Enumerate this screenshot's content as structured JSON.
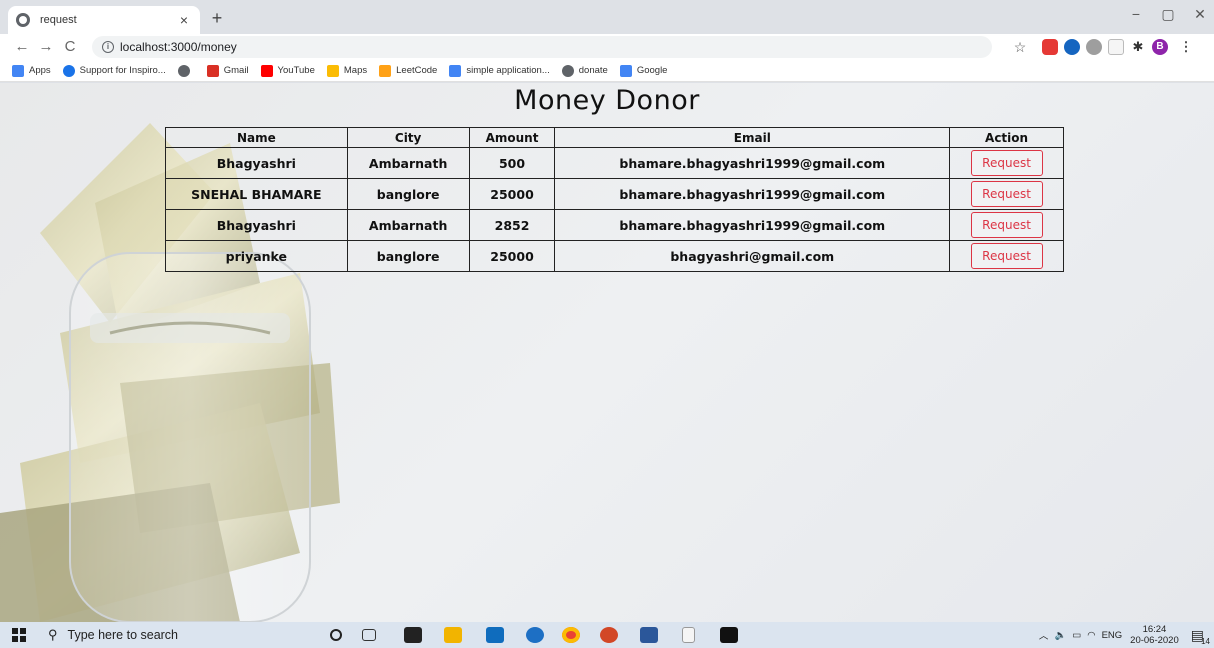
{
  "browser": {
    "tab_title": "request",
    "tab_close": "×",
    "new_tab": "+",
    "url": "localhost:3000/money",
    "window_controls": {
      "minimize": "−",
      "restore": "▢",
      "close": "✕"
    },
    "nav": {
      "back": "←",
      "forward": "→",
      "reload": "C"
    },
    "profile_initial": "B"
  },
  "bookmarks": [
    {
      "label": "Apps",
      "icon": "apps-grid-icon",
      "color": "#4285f4"
    },
    {
      "label": "Support for Inspiro...",
      "icon": "inspiro-icon",
      "color": "#1a73e8"
    },
    {
      "label": "",
      "icon": "globe-icon",
      "color": "#5f6368"
    },
    {
      "label": "Gmail",
      "icon": "gmail-icon",
      "color": "#d93025"
    },
    {
      "label": "YouTube",
      "icon": "youtube-icon",
      "color": "#ff0000"
    },
    {
      "label": "Maps",
      "icon": "maps-icon",
      "color": "#fbbc04"
    },
    {
      "label": "LeetCode",
      "icon": "leetcode-icon",
      "color": "#ffa116"
    },
    {
      "label": "simple application...",
      "icon": "google-g-icon",
      "color": "#4285f4"
    },
    {
      "label": "donate",
      "icon": "globe-icon",
      "color": "#5f6368"
    },
    {
      "label": "Google",
      "icon": "google-g-icon",
      "color": "#4285f4"
    }
  ],
  "page": {
    "title": "Money Donor",
    "table": {
      "headers": [
        "Name",
        "City",
        "Amount",
        "Email",
        "Action"
      ],
      "rows": [
        {
          "name": "Bhagyashri",
          "city": "Ambarnath",
          "amount": "500",
          "email": "bhamare.bhagyashri1999@gmail.com",
          "action": "Request"
        },
        {
          "name": "SNEHAL BHAMARE",
          "city": "banglore",
          "amount": "25000",
          "email": "bhamare.bhagyashri1999@gmail.com",
          "action": "Request"
        },
        {
          "name": "Bhagyashri",
          "city": "Ambarnath",
          "amount": "2852",
          "email": "bhamare.bhagyashri1999@gmail.com",
          "action": "Request"
        },
        {
          "name": "priyanke",
          "city": "banglore",
          "amount": "25000",
          "email": "bhagyashri@gmail.com",
          "action": "Request"
        }
      ]
    },
    "accent_color": "#dc3545"
  },
  "taskbar": {
    "search_placeholder": "Type here to search",
    "tray": {
      "lang": "ENG",
      "time": "16:24",
      "date": "20-06-2020",
      "notifications": "14"
    }
  }
}
